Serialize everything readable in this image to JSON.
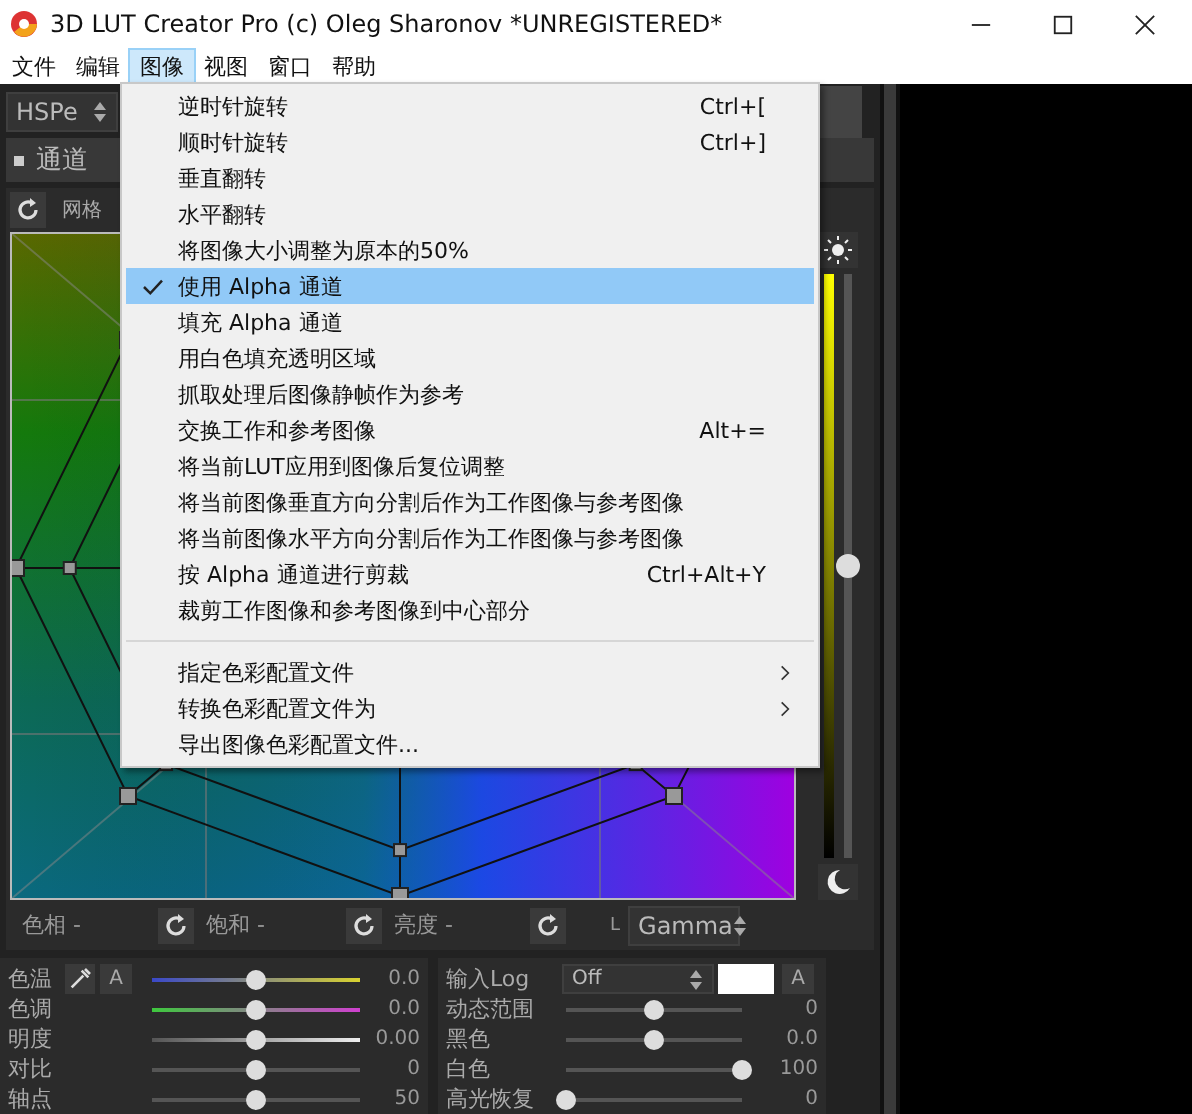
{
  "window": {
    "title": "3D LUT Creator Pro (c) Oleg Sharonov *UNREGISTERED*"
  },
  "menubar": [
    {
      "label": "文件",
      "selected": false
    },
    {
      "label": "编辑",
      "selected": false
    },
    {
      "label": "图像",
      "selected": true
    },
    {
      "label": "视图",
      "selected": false
    },
    {
      "label": "窗口",
      "selected": false
    },
    {
      "label": "帮助",
      "selected": false
    }
  ],
  "toolbar": {
    "mode": "HSPe"
  },
  "panel": {
    "title": "通道",
    "grid_label": "网格"
  },
  "vertical_slider": {
    "level": 0.5
  },
  "axes": [
    {
      "label": "色相 -"
    },
    {
      "label": "饱和 -"
    },
    {
      "label": "亮度 -"
    }
  ],
  "curve": {
    "axis": "L",
    "value": "Gamma"
  },
  "adjustments": [
    {
      "label": "色温",
      "kind": "temperature",
      "level": 0.5,
      "reading": "0.0",
      "auto_button": "A"
    },
    {
      "label": "色调",
      "kind": "tint",
      "level": 0.5,
      "reading": "0.0"
    },
    {
      "label": "明度",
      "kind": "brightness",
      "level": 0.5,
      "reading": "0.00"
    },
    {
      "label": "对比",
      "kind": "plain",
      "level": 0.5,
      "reading": "0"
    },
    {
      "label": "轴点",
      "kind": "plain",
      "level": 0.5,
      "reading": "50"
    }
  ],
  "log": {
    "label": "输入Log",
    "value": "Off",
    "auto_button": "A"
  },
  "log_sliders": [
    {
      "label": "动态范围",
      "level": 0.5,
      "reading": "0"
    },
    {
      "label": "黑色",
      "level": 0.5,
      "reading": "0.0"
    },
    {
      "label": "白色",
      "level": 1,
      "reading": "100"
    },
    {
      "label": "高光恢复",
      "level": 0,
      "reading": "0"
    }
  ],
  "menu": [
    {
      "kind": "item",
      "label": "逆时针旋转",
      "shortcut": "Ctrl+[",
      "checked": false,
      "selected": false
    },
    {
      "kind": "item",
      "label": "顺时针旋转",
      "shortcut": "Ctrl+]",
      "checked": false,
      "selected": false
    },
    {
      "kind": "item",
      "label": "垂直翻转",
      "checked": false,
      "selected": false
    },
    {
      "kind": "item",
      "label": "水平翻转",
      "checked": false,
      "selected": false
    },
    {
      "kind": "item",
      "label": "将图像大小调整为原本的50%",
      "checked": false,
      "selected": false
    },
    {
      "kind": "item",
      "label": "使用 Alpha 通道",
      "checked": true,
      "selected": true
    },
    {
      "kind": "item",
      "label": "填充 Alpha 通道",
      "checked": false,
      "selected": false
    },
    {
      "kind": "item",
      "label": "用白色填充透明区域",
      "checked": false,
      "selected": false
    },
    {
      "kind": "item",
      "label": "抓取处理后图像静帧作为参考",
      "checked": false,
      "selected": false
    },
    {
      "kind": "item",
      "label": "交换工作和参考图像",
      "shortcut": "Alt+=",
      "checked": false,
      "selected": false
    },
    {
      "kind": "item",
      "label": "将当前LUT应用到图像后复位调整",
      "checked": false,
      "selected": false
    },
    {
      "kind": "item",
      "label": "将当前图像垂直方向分割后作为工作图像与参考图像",
      "checked": false,
      "selected": false
    },
    {
      "kind": "item",
      "label": "将当前图像水平方向分割后作为工作图像与参考图像",
      "checked": false,
      "selected": false
    },
    {
      "kind": "item",
      "label": "按 Alpha 通道进行剪裁",
      "shortcut": "Ctrl+Alt+Y",
      "checked": false,
      "selected": false
    },
    {
      "kind": "item",
      "label": "裁剪工作图像和参考图像到中心部分",
      "checked": false,
      "selected": false
    },
    {
      "kind": "separator"
    },
    {
      "kind": "submenu",
      "label": "指定色彩配置文件",
      "checked": false,
      "selected": false
    },
    {
      "kind": "submenu",
      "label": "转换色彩配置文件为",
      "checked": false,
      "selected": false
    },
    {
      "kind": "item",
      "label": "导出图像色彩配置文件...",
      "checked": false,
      "selected": false
    }
  ]
}
